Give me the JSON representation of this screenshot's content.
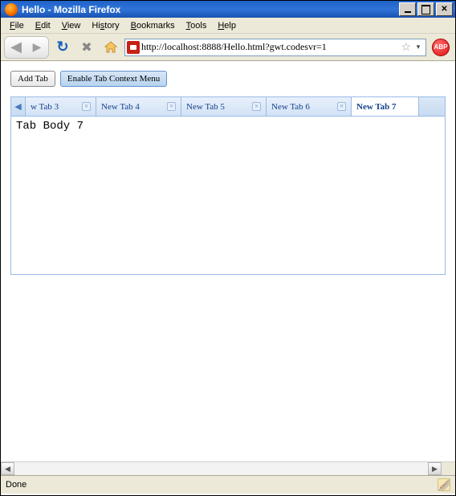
{
  "window": {
    "title": "Hello - Mozilla Firefox",
    "controls": {
      "minimize": "min",
      "maximize": "max",
      "close": "close"
    }
  },
  "menubar": {
    "file": "File",
    "edit": "Edit",
    "view": "View",
    "history": "History",
    "bookmarks": "Bookmarks",
    "tools": "Tools",
    "help": "Help"
  },
  "toolbar": {
    "back_tip": "Back",
    "forward_tip": "Forward",
    "reload_tip": "Reload",
    "stop_tip": "Stop",
    "home_tip": "Home",
    "url": "http://localhost:8888/Hello.html?gwt.codesvr=1",
    "abp_label": "ABP"
  },
  "page": {
    "add_tab_label": "Add Tab",
    "context_menu_label": "Enable Tab Context Menu",
    "tabs": [
      {
        "label": "w Tab 3",
        "closable": true,
        "active": false
      },
      {
        "label": "New Tab 4",
        "closable": true,
        "active": false
      },
      {
        "label": "New Tab 5",
        "closable": true,
        "active": false
      },
      {
        "label": "New Tab 6",
        "closable": true,
        "active": false
      },
      {
        "label": "New Tab 7",
        "closable": false,
        "active": true
      }
    ],
    "body_text": "Tab Body 7"
  },
  "statusbar": {
    "text": "Done"
  },
  "colors": {
    "panel_border": "#99bbe8",
    "tab_text": "#15428b",
    "chrome_bg": "#ece9d8"
  }
}
